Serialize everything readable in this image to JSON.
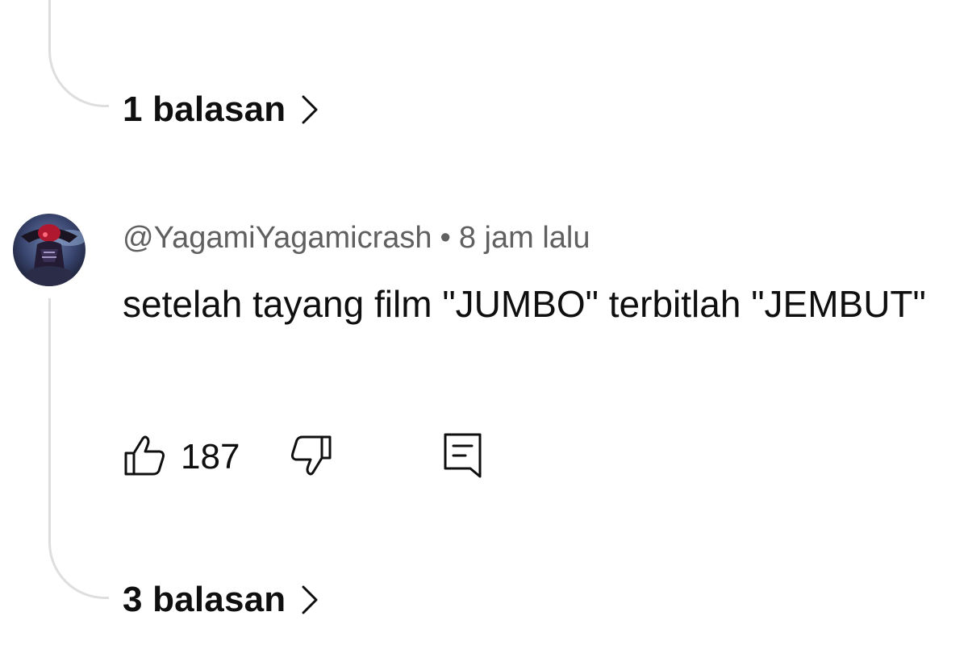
{
  "thread_top": {
    "replies_label": "1 balasan"
  },
  "comment": {
    "author": "@YagamiYagamicrash",
    "separator": "•",
    "time": "8 jam lalu",
    "text": "setelah tayang film \"JUMBO\" terbitlah \"JEMBUT\"",
    "likes": "187",
    "replies_label": "3 balasan"
  },
  "icons": {
    "like": "thumbs-up-icon",
    "dislike": "thumbs-down-icon",
    "reply": "comment-reply-icon",
    "chevron": "chevron-right-icon"
  },
  "colors": {
    "text": "#0f0f0f",
    "secondary_text": "#606060",
    "thread_line": "#dedede",
    "background": "#ffffff"
  }
}
